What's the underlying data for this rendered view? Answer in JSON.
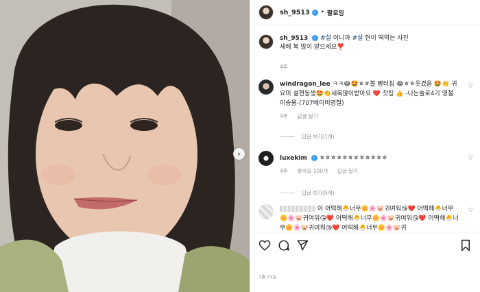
{
  "post": {
    "username": "sh_9513",
    "follow_label": "팔로잉",
    "date": "1월 31일"
  },
  "caption": {
    "username": "sh_9513",
    "tag1": "#설",
    "mid1": " 이니까 ",
    "tag2": "#설",
    "mid2": " 현이 떡먹는 사진",
    "line2": "새해 복 많이 받으세요❣️",
    "time": "4주"
  },
  "comments": [
    {
      "username": "windragon_lee",
      "text": "ㅋㅋ😂🤩ㅎㅎ볼 빵터짐 😂ㅎㅎ웃겼음 🤩👏 귀요미 설현동생🤩👏새복많이받아요 ❤️ 찻팅 👍 -나는솔로4기 영철 이승용-(707베이비영철)",
      "time": "4주",
      "reply_label": "답글 달기",
      "view_replies": "답글 보기(1개)"
    },
    {
      "username": "luxekim",
      "text": "ㅎㅎㅎㅎㅎㅎㅎㅎㅎㅎㅎㅎ",
      "time": "4주",
      "likes": "좋아요 100개",
      "reply_label": "답글 달기",
      "view_replies": "답글 보기(5개)"
    },
    {
      "username_hidden": true,
      "text": "아 어떡해🐣너무🌼🌸🐷귀여워😘❤️ 어떡해🐣너무🌼🌸🐷귀여워😘❤️ 어떡해🐣너무🌼🌸🐷귀여워😘❤️ 어떡해🐣너무🌼🌸🐷귀여워😘❤️ 어떡해🐣너무🌼🌸🐷귀"
    }
  ],
  "icons": [
    "verified-icon",
    "heart-icon",
    "comment-icon",
    "share-icon",
    "bookmark-icon",
    "chevron-right-icon"
  ],
  "colors": {
    "link": "#00376b",
    "verified": "#3897f0",
    "muted": "#8e8e8e"
  }
}
